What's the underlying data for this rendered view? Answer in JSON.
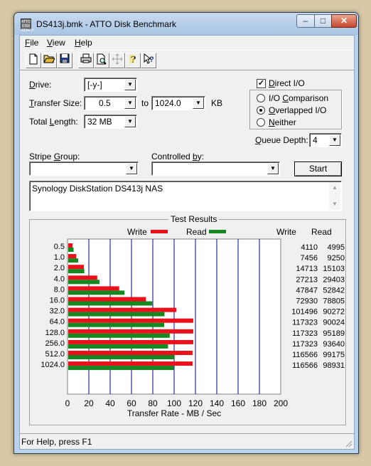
{
  "window": {
    "title": "DS413j.bmk - ATTO Disk Benchmark",
    "icon_text": "ATTO DISK BENCH",
    "controls": {
      "minimize": "–",
      "maximize": "□",
      "close": "✕"
    }
  },
  "menu": {
    "items": [
      {
        "key": "F",
        "rest": "ile"
      },
      {
        "key": "V",
        "rest": "iew"
      },
      {
        "key": "H",
        "rest": "elp"
      }
    ]
  },
  "toolbar": {
    "buttons": [
      "new-file-icon",
      "open-folder-icon",
      "save-icon",
      "print-icon",
      "print-preview-icon",
      "move-icon",
      "help-icon",
      "context-help-icon"
    ]
  },
  "form": {
    "drive_label_key": "D",
    "drive_label_rest": "rive:",
    "drive_value": "[-y-]",
    "transfer_label_key": "T",
    "transfer_label_rest": "ransfer Size:",
    "transfer_from": "0.5",
    "to_label": "to",
    "transfer_to": "1024.0",
    "kb_label": "KB",
    "length_label_pre": "Total ",
    "length_label_key": "L",
    "length_label_rest": "ength:",
    "length_value": "32 MB",
    "direct_io_label_key": "D",
    "direct_io_label_rest": "irect I/O",
    "direct_io_checked": true,
    "io_comparison_label_pre": "I/O ",
    "io_comparison_label_key": "C",
    "io_comparison_label_rest": "omparison",
    "overlapped_label_key": "O",
    "overlapped_label_rest": "verlapped I/O",
    "neither_label_key": "N",
    "neither_label_rest": "either",
    "selected_mode": "overlapped",
    "queue_label_key": "Q",
    "queue_label_rest": "ueue Depth:",
    "queue_value": "4",
    "stripe_label_pre": "Stripe ",
    "stripe_label_key": "G",
    "stripe_label_rest": "roup:",
    "controlled_label_pre": "Controlled ",
    "controlled_label_key": "b",
    "controlled_label_rest": "y:",
    "start_label": "Start",
    "description": "Synology DiskStation DS413j NAS"
  },
  "results": {
    "title": "Test Results",
    "write_legend": "Write",
    "read_legend": "Read",
    "write_header": "Write",
    "read_header": "Read",
    "write_color": "#e8101b",
    "read_color": "#16871e"
  },
  "status": {
    "text": "For Help, press F1"
  },
  "chart_data": {
    "type": "bar",
    "orientation": "horizontal",
    "xlabel": "Transfer Rate - MB / Sec",
    "xlim": [
      0,
      200
    ],
    "xticks": [
      0,
      20,
      40,
      60,
      80,
      100,
      120,
      140,
      160,
      180,
      200
    ],
    "grid": true,
    "categories": [
      "0.5",
      "1.0",
      "2.0",
      "4.0",
      "8.0",
      "16.0",
      "32.0",
      "64.0",
      "128.0",
      "256.0",
      "512.0",
      "1024.0"
    ],
    "series": [
      {
        "name": "Write",
        "values": [
          4.1,
          7.5,
          14.7,
          27.2,
          47.8,
          72.9,
          101.5,
          117.3,
          117.3,
          117.3,
          116.6,
          116.6
        ]
      },
      {
        "name": "Read",
        "values": [
          5.0,
          9.3,
          15.1,
          29.4,
          52.8,
          78.8,
          90.3,
          90.0,
          95.2,
          93.6,
          99.2,
          98.9
        ]
      }
    ],
    "table": {
      "write": [
        "4110",
        "7456",
        "14713",
        "27213",
        "47847",
        "72930",
        "101496",
        "117323",
        "117323",
        "117323",
        "116566",
        "116566"
      ],
      "read": [
        "4995",
        "9250",
        "15103",
        "29403",
        "52842",
        "78805",
        "90272",
        "90024",
        "95189",
        "93640",
        "99175",
        "98931"
      ]
    }
  }
}
